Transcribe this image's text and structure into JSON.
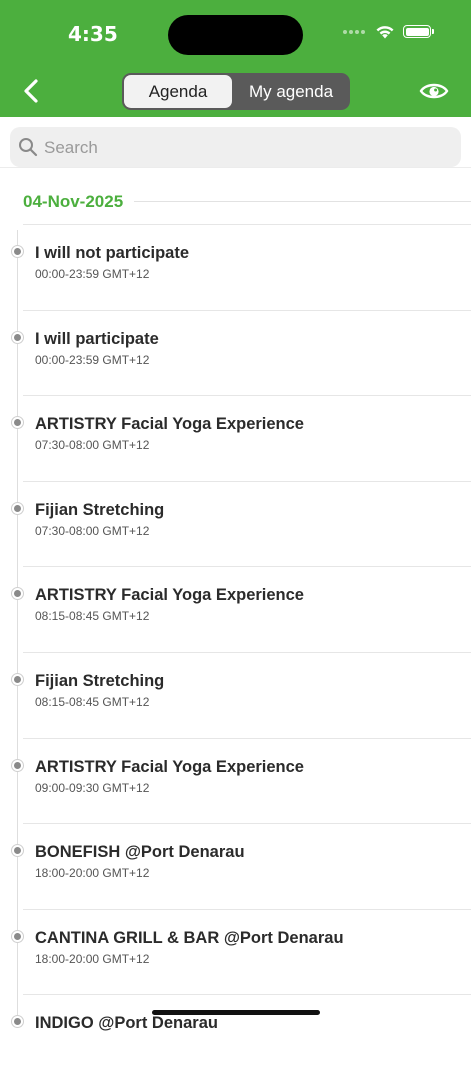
{
  "status_bar": {
    "time": "4:35"
  },
  "header": {
    "segments": [
      {
        "label": "Agenda",
        "active": true
      },
      {
        "label": "My agenda",
        "active": false
      }
    ],
    "accent_color": "#4caf3e"
  },
  "search": {
    "placeholder": "Search",
    "value": ""
  },
  "agenda": {
    "date": "04-Nov-2025",
    "items": [
      {
        "title": "I will not participate",
        "time": "00:00-23:59 GMT+12"
      },
      {
        "title": "I will participate",
        "time": "00:00-23:59 GMT+12"
      },
      {
        "title": "ARTISTRY Facial Yoga Experience",
        "time": "07:30-08:00 GMT+12"
      },
      {
        "title": "Fijian Stretching",
        "time": "07:30-08:00 GMT+12"
      },
      {
        "title": "ARTISTRY Facial Yoga Experience",
        "time": "08:15-08:45 GMT+12"
      },
      {
        "title": "Fijian Stretching",
        "time": "08:15-08:45 GMT+12"
      },
      {
        "title": "ARTISTRY Facial Yoga Experience",
        "time": "09:00-09:30 GMT+12"
      },
      {
        "title": "BONEFISH @Port Denarau",
        "time": "18:00-20:00 GMT+12"
      },
      {
        "title": "CANTINA GRILL & BAR @Port Denarau",
        "time": "18:00-20:00 GMT+12"
      },
      {
        "title": "INDIGO @Port Denarau",
        "time": ""
      }
    ]
  }
}
